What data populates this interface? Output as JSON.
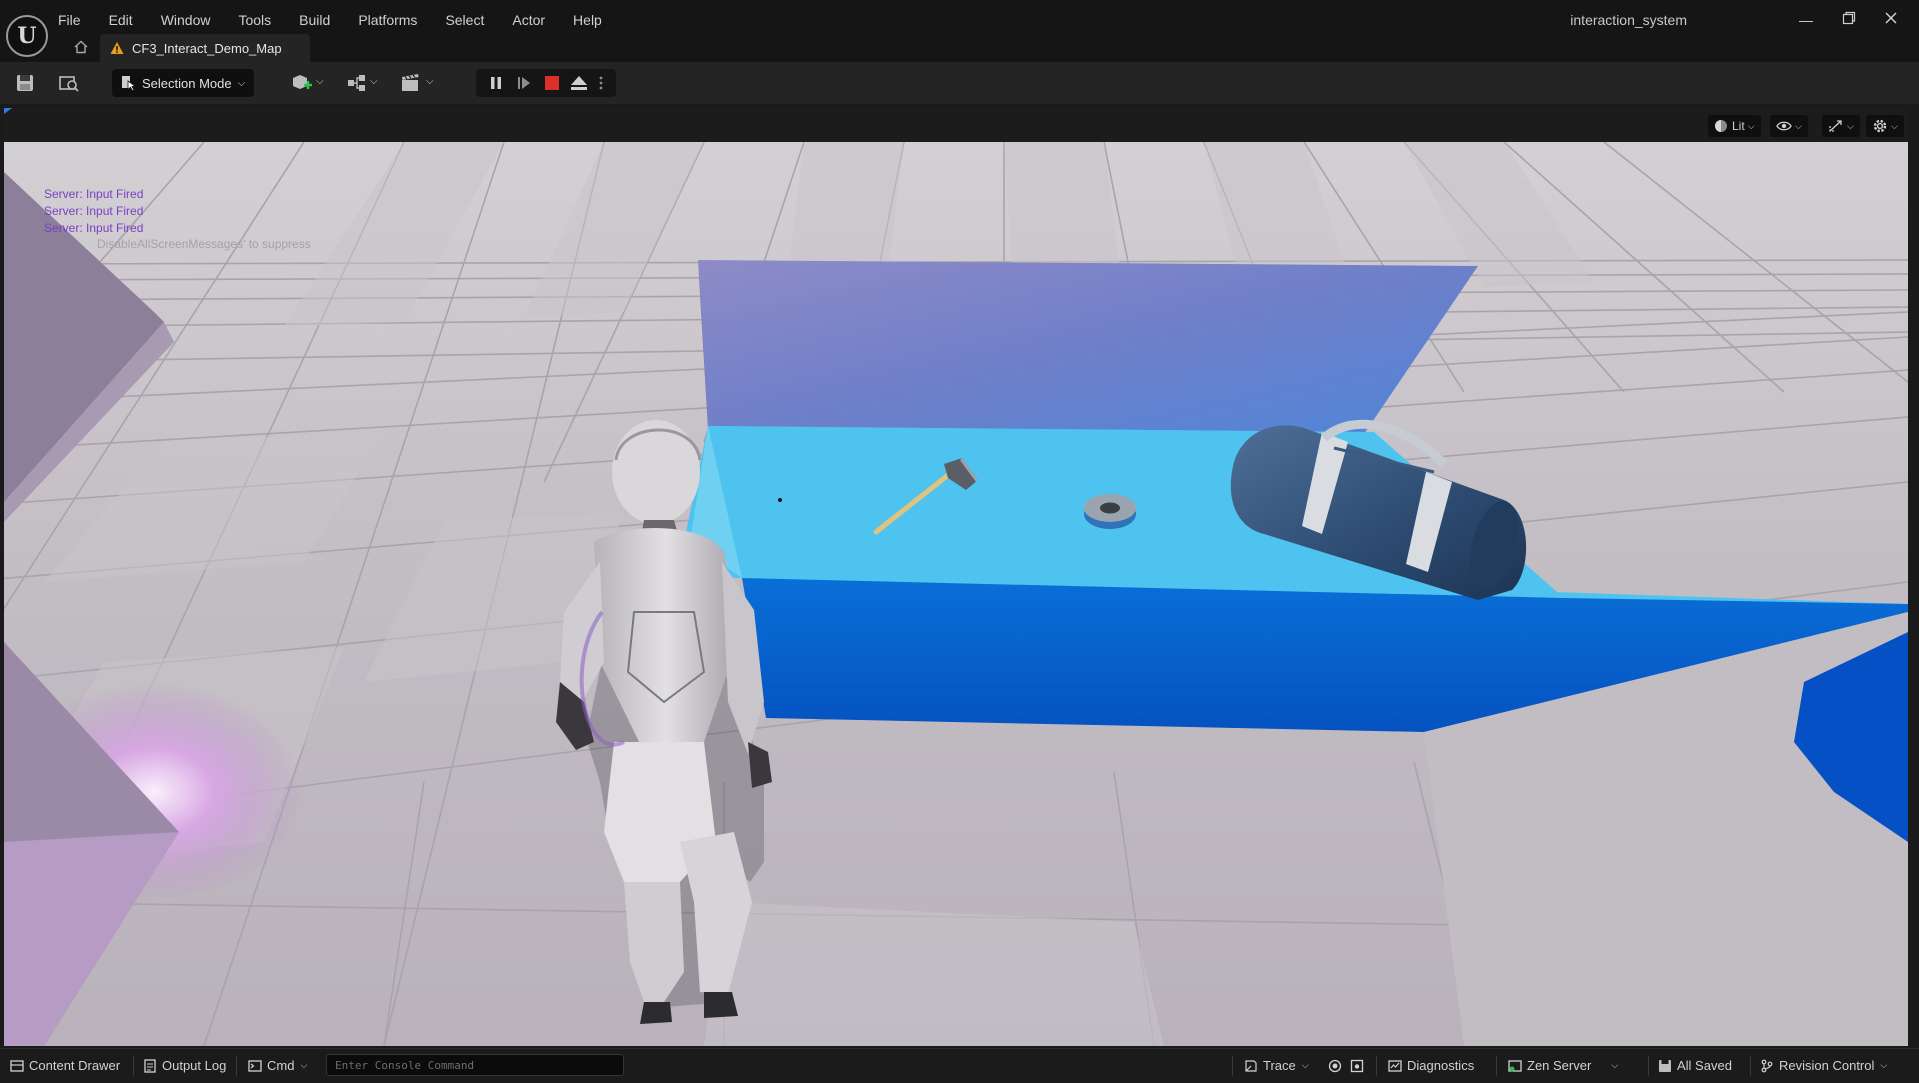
{
  "app": {
    "project_name": "interaction_system",
    "logo_letter": "U"
  },
  "menu": [
    "File",
    "Edit",
    "Window",
    "Tools",
    "Build",
    "Platforms",
    "Select",
    "Actor",
    "Help"
  ],
  "tab": {
    "label": "CF3_Interact_Demo_Map"
  },
  "toolbar": {
    "selection_mode_label": "Selection Mode",
    "play_state": "playing"
  },
  "viewport": {
    "lit_label": "Lit",
    "messages": [
      "Server: Input Fired",
      "Server: Input Fired",
      "Server: Input Fired"
    ],
    "suppress_hint": "DisableAllScreenMessages' to suppress"
  },
  "statusbar": {
    "content_drawer": "Content Drawer",
    "output_log": "Output Log",
    "cmd_label": "Cmd",
    "console_placeholder": "Enter Console Command",
    "trace": "Trace",
    "diagnostics": "Diagnostics",
    "zen_server": "Zen Server",
    "all_saved": "All Saved",
    "revision_control": "Revision Control"
  },
  "colors": {
    "stop_red": "#d9302b",
    "table_top": "#4ec3ef",
    "table_front": "#0a6fd8",
    "message_purple": "#7b3fc2",
    "warning_orange": "#e6a020"
  }
}
